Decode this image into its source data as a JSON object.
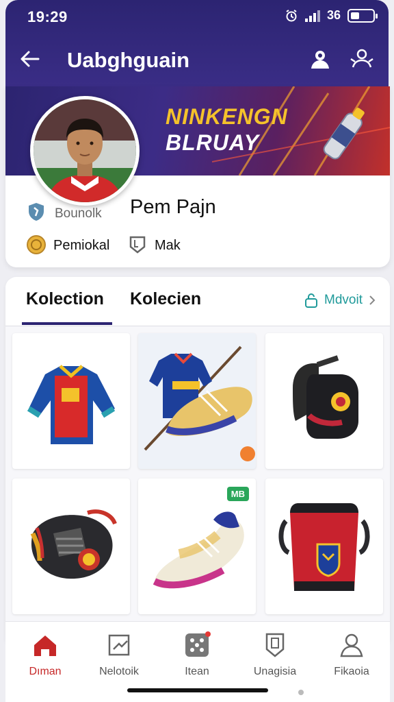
{
  "status_bar": {
    "time": "19:29",
    "network": "36"
  },
  "app_bar": {
    "title": "Uabghguain",
    "back_icon": "arrow-left-icon",
    "action_icons": [
      "user-account-icon",
      "team-icon"
    ]
  },
  "profile": {
    "banner_line1": "NINKENGN",
    "banner_line2": "BLRUAY",
    "player_name": "Pem Pajn",
    "meta1_label": "Bounolk",
    "meta2_label": "Pemiokal",
    "meta3_label": "Mak"
  },
  "collection": {
    "tabs": [
      {
        "label": "Kolection",
        "active": true
      },
      {
        "label": "Kolecien",
        "active": false
      }
    ],
    "more_label": "Mdvoit",
    "items": [
      {
        "name": "jersey",
        "badge": ""
      },
      {
        "name": "jersey-boot-stick",
        "badge": ""
      },
      {
        "name": "shin-guard",
        "badge": ""
      },
      {
        "name": "knee-pad",
        "badge": ""
      },
      {
        "name": "boot",
        "badge": "MB"
      },
      {
        "name": "bag",
        "badge": ""
      }
    ]
  },
  "bottom_nav": [
    {
      "label": "Dıman",
      "icon": "home-icon",
      "active": true
    },
    {
      "label": "Nelotoik",
      "icon": "chart-icon",
      "active": false
    },
    {
      "label": "Itean",
      "icon": "dice-icon",
      "active": false
    },
    {
      "label": "Unagisia",
      "icon": "shield-icon",
      "active": false
    },
    {
      "label": "Fikaoia",
      "icon": "profile-icon",
      "active": false
    }
  ],
  "colors": {
    "primary": "#2c2472",
    "accent": "#c62828",
    "teal": "#1f9a9a",
    "gold": "#f4c22b"
  }
}
